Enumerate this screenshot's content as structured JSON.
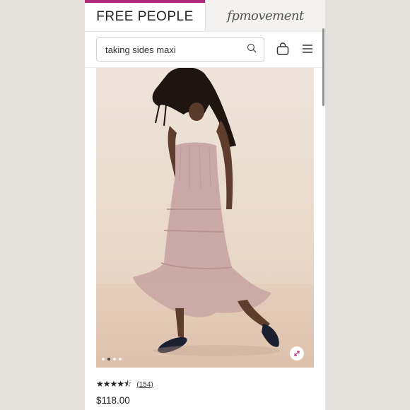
{
  "header": {
    "tabs": [
      {
        "label": "FREE PEOPLE",
        "active": true
      },
      {
        "label": "fpmovement",
        "active": false
      }
    ],
    "accent_color": "#b0287a"
  },
  "search": {
    "value": "taking sides maxi",
    "icon": "search-icon"
  },
  "toolbar": {
    "bag_icon": "shopping-bag-icon",
    "menu_icon": "hamburger-menu-icon"
  },
  "product": {
    "image_slides": 4,
    "active_slide": 2,
    "rating": 4.5,
    "stars_text": "★★★★⯪",
    "review_count": "(154)",
    "price": "$118.00"
  }
}
